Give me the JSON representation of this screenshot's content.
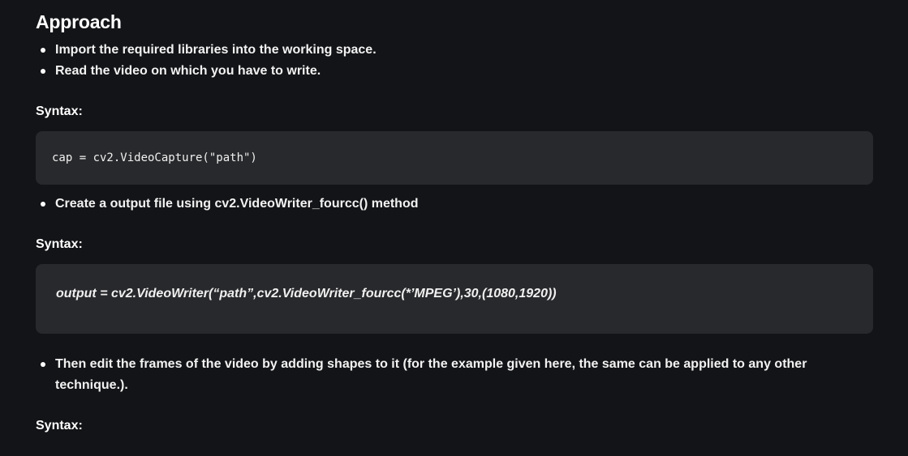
{
  "section": {
    "heading": "Approach"
  },
  "bullets_1": [
    "Import the required libraries into the working space.",
    "Read the video on which you have to write."
  ],
  "syntax_1": {
    "label": "Syntax:",
    "code": "cap = cv2.VideoCapture(\"path\")"
  },
  "bullets_2": [
    "Create a output file using cv2.VideoWriter_fourcc() method"
  ],
  "syntax_2": {
    "label": "Syntax:",
    "code": "output = cv2.VideoWriter(“path”,cv2.VideoWriter_fourcc(*’MPEG’),30,(1080,1920))"
  },
  "bullets_3": [
    "Then edit the frames of the video by adding shapes to it (for the example given here, the same can be applied to any other technique.)."
  ],
  "syntax_3": {
    "label": "Syntax:"
  },
  "colors": {
    "background": "#131417",
    "code_background": "#28292c",
    "text": "#ffffff"
  }
}
